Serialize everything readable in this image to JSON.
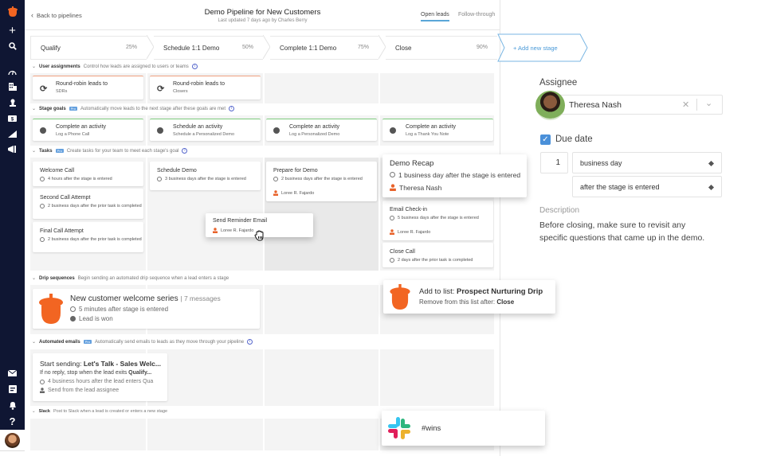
{
  "sidebar": {
    "icons": [
      "logo-acorn",
      "plus",
      "search",
      "dashboard",
      "companies",
      "contacts",
      "deals",
      "reports",
      "campaigns",
      "email",
      "tasks",
      "notifications",
      "help"
    ]
  },
  "header": {
    "back_label": "Back to pipelines",
    "title": "Demo Pipeline for New Customers",
    "subtitle": "Last updated 7 days ago by Charles Berry",
    "tabs": [
      {
        "label": "Open leads",
        "active": true
      },
      {
        "label": "Follow-through",
        "active": false
      }
    ]
  },
  "stages": [
    {
      "name": "Qualify",
      "percent": "25%"
    },
    {
      "name": "Schedule 1:1 Demo",
      "percent": "50%"
    },
    {
      "name": "Complete 1:1 Demo",
      "percent": "75%"
    },
    {
      "name": "Close",
      "percent": "90%"
    }
  ],
  "add_stage_label": "+ Add new stage",
  "sections": {
    "user_assignments": {
      "title": "User assignments",
      "desc": "Control how leads are assigned to users or teams",
      "cards": [
        {
          "title": "Round-robin leads to",
          "sub": "SDRs"
        },
        {
          "title": "Round-robin leads to",
          "sub": "Closers"
        }
      ]
    },
    "stage_goals": {
      "title": "Stage goals",
      "badge": "Pro",
      "desc": "Automatically move leads to the next stage after these goals are met",
      "cards": [
        {
          "title": "Complete an activity",
          "sub": "Log a Phone Call"
        },
        {
          "title": "Schedule an activity",
          "sub": "Schedule a Personalized Demo"
        },
        {
          "title": "Complete an activity",
          "sub": "Log a Personalized Demo"
        },
        {
          "title": "Complete an activity",
          "sub": "Log a Thank You Note"
        }
      ]
    },
    "tasks": {
      "title": "Tasks",
      "badge": "Pro",
      "desc": "Create tasks for your team to meet each stage's goal",
      "col1": [
        {
          "title": "Welcome Call",
          "timing": "4 hours after the stage is entered"
        },
        {
          "title": "Second Call Attempt",
          "timing": "2 business days after the prior task is completed"
        },
        {
          "title": "Final Call Attempt",
          "timing": "2 business days after the prior task is completed"
        }
      ],
      "col2": [
        {
          "title": "Schedule Demo",
          "timing": "3 business days after the stage is entered"
        }
      ],
      "col3": [
        {
          "title": "Prepare for Demo",
          "timing": "2 business days after the stage is entered",
          "assignee": "Loree R. Fajardo"
        }
      ],
      "col4": [
        {
          "title": "Email Check-in",
          "timing": "5 business days after the stage is entered",
          "assignee": "Loree R. Fajardo"
        },
        {
          "title": "Close Call",
          "timing": "2 days after the prior task is completed"
        }
      ],
      "dragging": {
        "title": "Send Reminder Email",
        "assignee": "Loree R. Fajardo"
      },
      "popout": {
        "title": "Demo Recap",
        "timing": "1 business day after the stage is entered",
        "assignee": "Theresa Nash"
      }
    },
    "drip": {
      "title": "Drip sequences",
      "desc": "Begin sending an automated drip sequence when a lead enters a stage",
      "card": {
        "name": "New customer welcome series",
        "count": "| 7 messages",
        "timing": "5 minutes after stage is entered",
        "condition": "Lead is won"
      },
      "popout": {
        "line1_prefix": "Add to list: ",
        "line1_bold": "Prospect Nurturing Drip",
        "line2_prefix": "Remove from this list after: ",
        "line2_bold": "Close"
      }
    },
    "auto_emails": {
      "title": "Automated emails",
      "badge": "Pro",
      "desc": "Automatically send emails to leads as they move through your pipeline",
      "card": {
        "line1_prefix": "Start sending: ",
        "line1_bold": "Let's Talk - Sales Welc...",
        "line2_prefix": "If no reply, stop when the lead exits ",
        "line2_bold": "Qualify...",
        "timing": "4 business hours after the lead enters Qua",
        "sender": "Send from the lead assignee"
      }
    },
    "slack": {
      "title": "Slack",
      "desc": "Post to Slack when a lead is created or enters a new stage",
      "popout": {
        "channel": "#wins"
      }
    }
  },
  "task_editor": {
    "assignee_label": "Assignee",
    "assignee_value": "Theresa Nash",
    "due_date_label": "Due date",
    "due_date_checked": true,
    "due_amount": "1",
    "due_unit": "business day",
    "due_relative": "after the stage is entered",
    "description_label": "Description",
    "description": "Before closing, make sure to revisit any specific questions that came up in the demo."
  },
  "colors": {
    "sidebar_bg": "#0f1633",
    "accent_blue": "#4a90d9",
    "brand_orange": "#f26522",
    "goal_green": "#7ecb7e",
    "assign_orange": "#f0a080"
  }
}
